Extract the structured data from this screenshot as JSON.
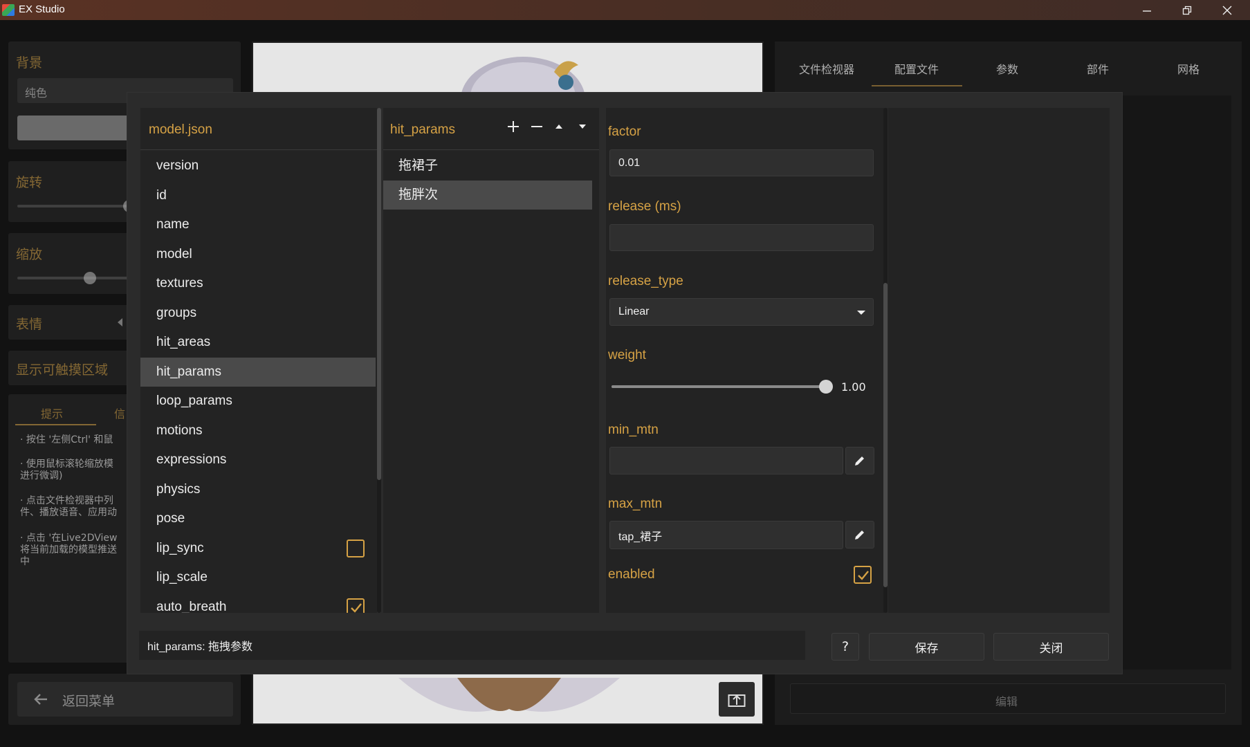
{
  "window": {
    "title": "EX Studio",
    "minimize_icon": "minimize-icon",
    "restore_icon": "restore-icon",
    "close_icon": "close-icon"
  },
  "background_app": {
    "background": {
      "label": "背景",
      "dropdown_value": "纯色"
    },
    "rotation": {
      "label": "旋转"
    },
    "scale": {
      "label": "缩放"
    },
    "expression": {
      "label": "表情"
    },
    "show_hit_areas": {
      "label": "显示可触摸区域"
    },
    "tips_tabs": [
      "提示",
      "信"
    ],
    "tips": [
      "· 按住 '左侧Ctrl' 和鼠",
      "· 使用鼠标滚轮缩放模",
      "进行微调)",
      "· 点击文件检视器中列",
      "件、播放语音、应用动",
      "· 点击 '在Live2DView",
      "将当前加载的模型推送",
      "中"
    ],
    "back_menu": "返回菜单",
    "right_tabs": [
      "文件检视器",
      "配置文件",
      "参数",
      "部件",
      "网格"
    ],
    "edit_button": "编辑"
  },
  "dialog": {
    "root": {
      "title": "model.json",
      "items": [
        {
          "label": "version"
        },
        {
          "label": "id"
        },
        {
          "label": "name"
        },
        {
          "label": "model"
        },
        {
          "label": "textures"
        },
        {
          "label": "groups"
        },
        {
          "label": "hit_areas"
        },
        {
          "label": "hit_params",
          "selected": true
        },
        {
          "label": "loop_params"
        },
        {
          "label": "motions"
        },
        {
          "label": "expressions"
        },
        {
          "label": "physics"
        },
        {
          "label": "pose"
        },
        {
          "label": "lip_sync",
          "checkbox": false
        },
        {
          "label": "lip_scale"
        },
        {
          "label": "auto_breath",
          "checkbox": true
        }
      ]
    },
    "params": {
      "title": "hit_params",
      "add_icon": "plus-icon",
      "remove_icon": "minus-icon",
      "up_icon": "triangle-up-icon",
      "down_icon": "triangle-down-icon",
      "items": [
        {
          "label": "拖裙子"
        },
        {
          "label": "拖胖次",
          "selected": true
        }
      ]
    },
    "detail": {
      "factor": {
        "label": "factor",
        "value": "0.01"
      },
      "release": {
        "label": "release (ms)",
        "value": ""
      },
      "release_type": {
        "label": "release_type",
        "value": "Linear"
      },
      "weight": {
        "label": "weight",
        "value": "1.00",
        "level": 1.0
      },
      "min_mtn": {
        "label": "min_mtn",
        "value": ""
      },
      "max_mtn": {
        "label": "max_mtn",
        "value": "tap_裙子"
      },
      "enabled": {
        "label": "enabled",
        "checked": true
      }
    },
    "status_text": "hit_params: 拖拽参数",
    "help_label": "?",
    "save_label": "保存",
    "close_label": "关闭"
  },
  "colors": {
    "accent": "#d6a245",
    "selection": "#4a4a4a",
    "panel": "#232323"
  }
}
